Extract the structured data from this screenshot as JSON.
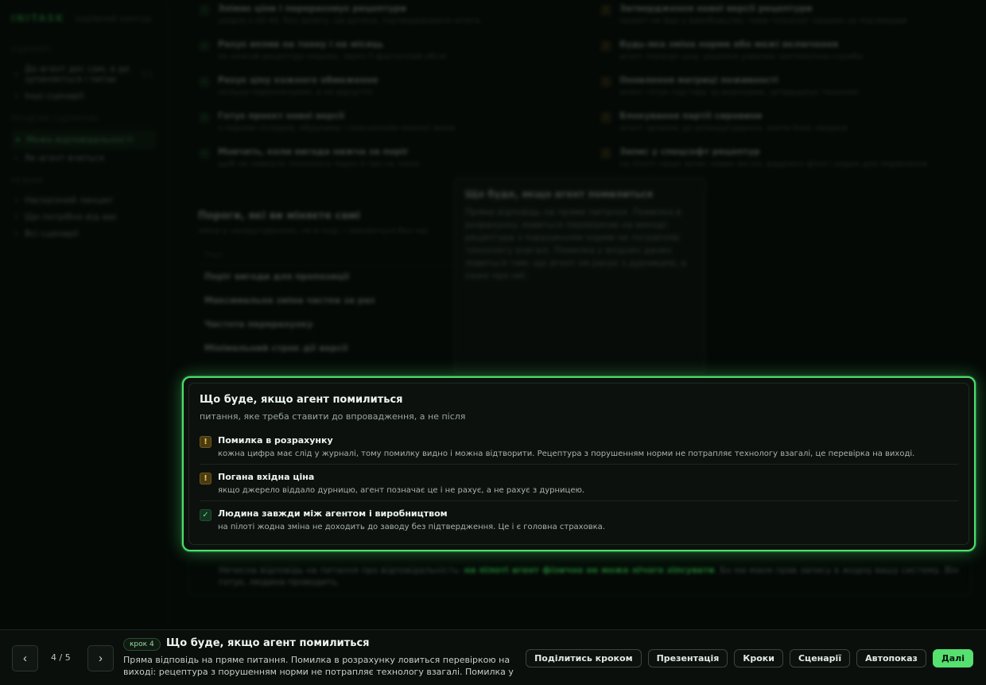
{
  "brand": {
    "logo": "INITASK",
    "subtitle": "керівний контур"
  },
  "sidebar": {
    "section1": "СЦЕНАРІЇ",
    "items1": [
      {
        "label": "До агент дос сам, а де зупиняється і питає",
        "num": "1/1"
      },
      {
        "label": "Інші сценарії",
        "num": ""
      }
    ],
    "section2": "РОЗДІЛИ СЦЕНАРІЮ",
    "items2": [
      {
        "label": "Межа відповідальності",
        "active": true
      },
      {
        "label": "Як агент вчиться",
        "active": false
      }
    ],
    "section3": "РЕЖИМ",
    "items3": [
      {
        "label": "Наскрізний ланцюг"
      },
      {
        "label": "Що потрібно від вас"
      },
      {
        "label": "Всі сценарії"
      }
    ]
  },
  "background": {
    "left_items": [
      {
        "title": "Знімає ціни і перераховує рецептури",
        "desc": "щодня о 05:40, без запиту. Це рутина, підтверджувати нічого."
      },
      {
        "title": "Рахує вплив на тонну і на місяць",
        "desc": "по кожній рецептурі окремо, через її фактичний обсяг"
      },
      {
        "title": "Рахує ціну кожного обмеження",
        "desc": "скільки переплачуємо, а не відчуття"
      },
      {
        "title": "Готує проєкт нової версії",
        "desc": "з повною складом, обраними і поясненням кожної зміни"
      },
      {
        "title": "Мовчить, коли вигода нижча за поріг",
        "desc": "щоб не смикати технолога через 4 грн на тонні"
      }
    ],
    "right_items": [
      {
        "title": "Затвердження нової версії рецептури",
        "desc": "проєкт не йде у виробництво, поки технолог свідомо не підтвердив"
      },
      {
        "title": "Будь-яка зміна норми або межі включення",
        "desc": "агент показує ціну, рішення ухвалює зоотехнічна служба"
      },
      {
        "title": "Оновлення матриці поживності",
        "desc": "агент готує підставу за аналізами, затверджує технолог"
      },
      {
        "title": "Блокування партії сировини",
        "desc": "агент зупиняє до розмаштування, зняти блок людина"
      },
      {
        "title": "Запис у спецсофт рецептур",
        "desc": "на пілоті лише запис нових вхі.ел, відділені фіолі і рядок для порівняння"
      }
    ],
    "thresholds_title": "Пороги, які ви міняєте самі",
    "thresholds_sub": "зміна у налаштуваннях, не в коді, і змінюється без нас",
    "thresholds_head": "Поріг",
    "thresholds": [
      "Поріг вигоди для пропозиції",
      "Максимальна зміна частки за раз",
      "Частота перерахунку",
      "Мінімальний строк дії версії"
    ],
    "popover_title": "Що буде, якщо агент помилиться",
    "popover_text": "Пряма відповідь на пряме питання. Помилка в розрахунку ловиться перевіркою на виході: рецептура з порушенням норми не потрапляє технологу взагалі. Помилка у вхідних даних ловиться тим, що агент не рахує з дурницею, а каже про неї.",
    "after_note_a": "Нечесна відповідь на питання про відповідальність: ",
    "after_note_b": "на пілоті агент фізично не може нічого зіпсувати",
    "after_note_c": ". Бо ми маєм прав запису в жодну вашу систему. Він готує, людина проводить."
  },
  "panel": {
    "title": "Що буде, якщо агент помилиться",
    "subtitle": "питання, яке треба ставити до впровадження, а не після",
    "items": [
      {
        "icon": "warning-icon",
        "kind": "warn",
        "glyph": "!",
        "title": "Помилка в розрахунку",
        "desc": "кожна цифра має слід у журналі, тому помилку видно і можна відтворити. Рецептура з порушенням норми не потрапляє технологу взагалі, це перевірка на виході."
      },
      {
        "icon": "warning-icon",
        "kind": "warn",
        "glyph": "!",
        "title": "Погана вхідна ціна",
        "desc": "якщо джерело віддало дурницю, агент позначає це і не рахує, а не рахує з дурницею."
      },
      {
        "icon": "check-icon",
        "kind": "ok",
        "glyph": "✓",
        "title": "Людина завжди між агентом і виробництвом",
        "desc": "на пілоті жодна зміна не доходить до заводу без підтвердження. Це і є головна страховка."
      }
    ]
  },
  "bottom": {
    "prev": "‹",
    "next": "›",
    "counter": "4 / 5",
    "step_badge": "крок 4",
    "step_title": "Що буде, якщо агент помилиться",
    "step_desc": "Пряма відповідь на пряме питання. Помилка в розрахунку ловиться перевіркою на виході: рецептура з порушенням норми не потрапляє технологу взагалі. Помилка у вхідних дан…",
    "actions": [
      "Поділитись кроком",
      "Презентація",
      "Кроки",
      "Сценарії",
      "Автопоказ",
      "Далі"
    ]
  },
  "colors": {
    "accent": "#4be06a",
    "warn": "#f2c94c",
    "background": "#070b08"
  }
}
